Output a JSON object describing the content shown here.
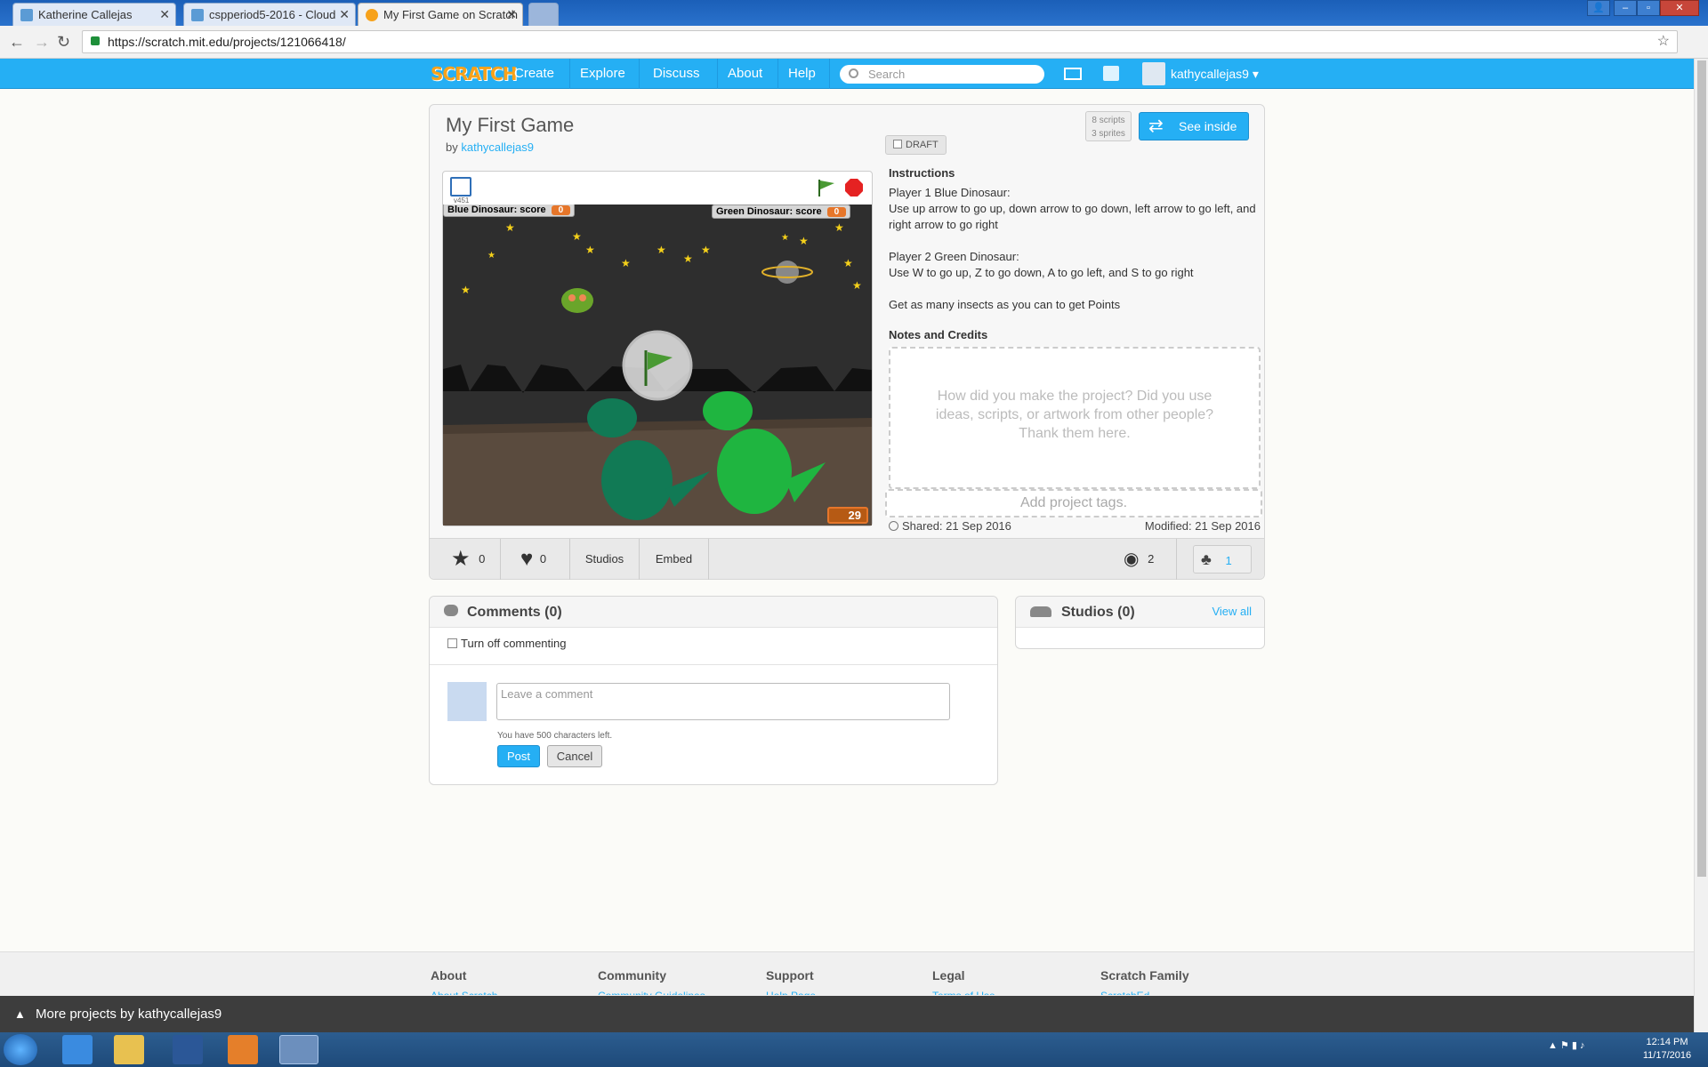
{
  "browser": {
    "tabs": [
      {
        "title": "Katherine Callejas"
      },
      {
        "title": "cspperiod5-2016 - Cloud"
      },
      {
        "title": "My First Game on Scratch"
      }
    ],
    "url": "https://scratch.mit.edu/projects/121066418/"
  },
  "header": {
    "logo": "SCRATCH",
    "nav": [
      "Create",
      "Explore",
      "Discuss",
      "About",
      "Help"
    ],
    "search_placeholder": "Search",
    "username": "kathycallejas9"
  },
  "project": {
    "title": "My First Game",
    "by_label": "by",
    "author": "kathycallejas9",
    "draft_label": "DRAFT",
    "scripts": "8 scripts",
    "sprites": "3 sprites",
    "see_inside": "See inside",
    "version": "v451",
    "stage": {
      "score1_label": "Blue Dinosaur: score",
      "score1_value": "0",
      "score2_label": "Green Dinosaur: score",
      "score2_value": "0",
      "timer": "29"
    },
    "instructions_header": "Instructions",
    "instructions": [
      "Player 1 Blue Dinosaur:",
      "Use up arrow to go up, down arrow to go down, left arrow to go left, and right arrow to go right",
      "Player 2 Green Dinosaur:",
      "Use W to go up, Z to go down, A to go left, and S to go right",
      "Get as many insects as you can to get Points"
    ],
    "notes_header": "Notes and Credits",
    "notes_placeholder": "How did you make the project? Did you use ideas, scripts, or artwork from other people? Thank them here.",
    "tags_placeholder": "Add project tags.",
    "shared": "Shared: 21 Sep 2016",
    "modified": "Modified: 21 Sep 2016",
    "stats": {
      "favorites": "0",
      "loves": "0",
      "studios_label": "Studios",
      "embed_label": "Embed",
      "views": "2",
      "remixes": "1"
    }
  },
  "comments": {
    "title": "Comments (0)",
    "turn_off_label": "Turn off commenting",
    "placeholder": "Leave a comment",
    "chars_left": "You have 500 characters left.",
    "post": "Post",
    "cancel": "Cancel"
  },
  "studios": {
    "title": "Studios (0)",
    "view_all": "View all"
  },
  "footer": {
    "columns": [
      {
        "title": "About",
        "link": "About Scratch"
      },
      {
        "title": "Community",
        "link": "Community Guidelines"
      },
      {
        "title": "Support",
        "link": "Help Page"
      },
      {
        "title": "Legal",
        "link": "Terms of Use"
      },
      {
        "title": "Scratch Family",
        "link": "ScratchEd"
      }
    ],
    "more_projects": "More projects by kathycallejas9"
  },
  "taskbar": {
    "time": "12:14 PM",
    "date": "11/17/2016"
  },
  "colors": {
    "scratch_blue": "#25aff4",
    "scratch_orange": "#f7a21b",
    "stop_red": "#e52222",
    "flag_green": "#4a9a34"
  }
}
